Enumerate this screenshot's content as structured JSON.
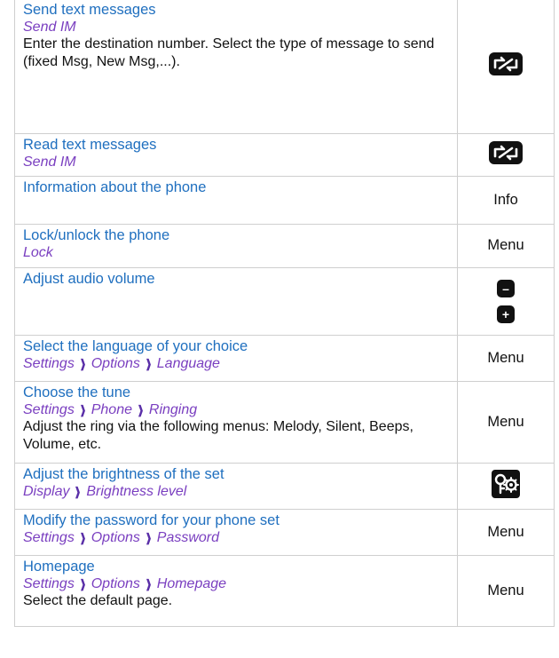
{
  "rows": [
    {
      "title": "Send text messages",
      "path": [
        "Send IM"
      ],
      "note": "Enter the destination number. Select the type of message to send (fixed Msg, New Msg,...).",
      "key": {
        "icon": "message-key-icon"
      }
    },
    {
      "title": "Read text messages",
      "path": [
        "Send IM"
      ],
      "note": "",
      "key": {
        "icon": "message-key-icon"
      }
    },
    {
      "title": "Information about the phone",
      "path": [],
      "note": "",
      "key": {
        "label": "Info"
      }
    },
    {
      "title": "Lock/unlock the phone",
      "path": [
        "Lock"
      ],
      "note": "",
      "key": {
        "label": "Menu"
      }
    },
    {
      "title": "Adjust audio volume",
      "path": [],
      "note": "",
      "key": {
        "minus": "–",
        "plus": "+"
      }
    },
    {
      "title": "Select the language of your choice",
      "path": [
        "Settings",
        "Options",
        "Language"
      ],
      "note": "",
      "key": {
        "label": "Menu"
      }
    },
    {
      "title": "Choose the tune",
      "path": [
        "Settings",
        "Phone",
        "Ringing"
      ],
      "note": "Adjust the ring via the following menus: Melody, Silent, Beeps, Volume, etc.",
      "key": {
        "label": "Menu"
      }
    },
    {
      "title": "Adjust the brightness of the set",
      "path": [
        "Display",
        "Brightness level"
      ],
      "note": "",
      "key": {
        "icon": "settings-key-icon"
      }
    },
    {
      "title": "Modify the password for your phone set",
      "path": [
        "Settings",
        "Options",
        "Password"
      ],
      "note": "",
      "key": {
        "label": "Menu"
      }
    },
    {
      "title": "Homepage",
      "path": [
        "Settings",
        "Options",
        "Homepage"
      ],
      "note": "Select the default page.",
      "key": {
        "label": "Menu"
      }
    }
  ],
  "separator": "❱",
  "colors": {
    "title": "#1f6fbf",
    "path": "#7a3fc0",
    "text": "#111111",
    "border": "#cfcfcf"
  }
}
